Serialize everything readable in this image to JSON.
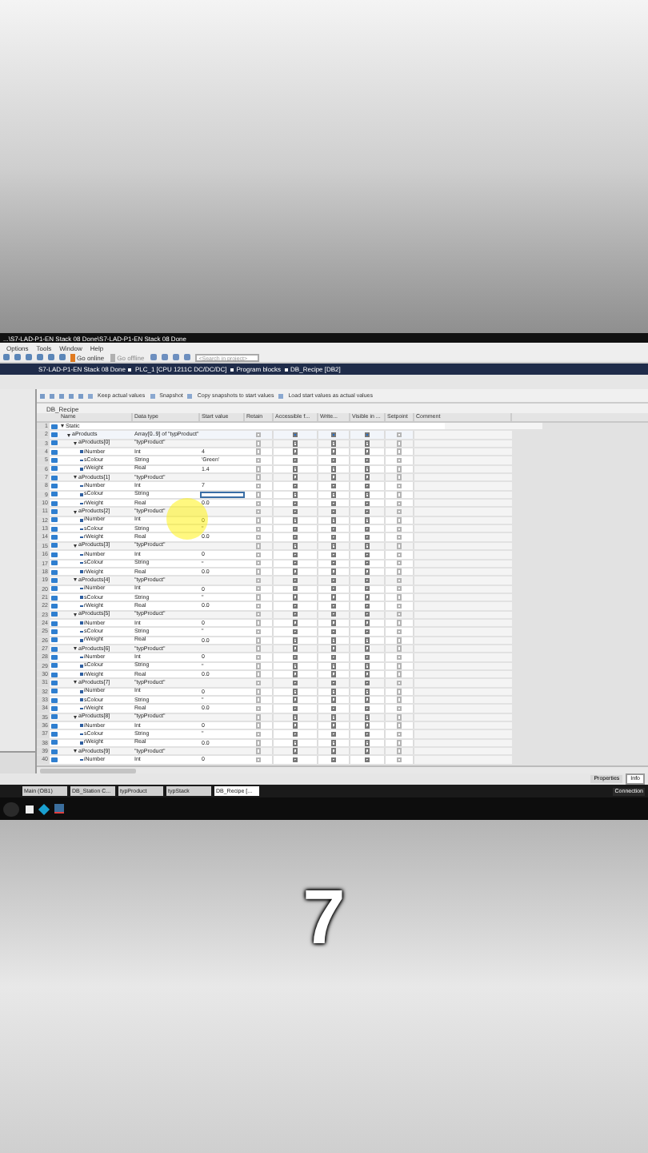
{
  "overlay_caption": "7",
  "window": {
    "title": "...\\S7-LAD-P1-EN Stack 08 Done\\S7-LAD-P1-EN Stack 08 Done"
  },
  "menu": [
    "Options",
    "Tools",
    "Window",
    "Help"
  ],
  "toolbar": {
    "go_online": "Go online",
    "go_offline": "Go offline",
    "search": {
      "placeholder": "<Search in project>"
    }
  },
  "breadcrumb": [
    "S7-LAD-P1-EN Stack 08 Done",
    "PLC_1 [CPU 1211C DC/DC/DC]",
    "Program blocks",
    "DB_Recipe [DB2]"
  ],
  "editor_toolbar": [
    "Keep actual values",
    "Snapshot",
    "Copy snapshots to start values",
    "Load start values as actual values"
  ],
  "block_title": "DB_Recipe",
  "table": {
    "columns": [
      "Name",
      "Data type",
      "Start value",
      "Retain",
      "Accessible f...",
      "Write...",
      "Visible in ...",
      "Setpoint",
      "Comment"
    ],
    "rows": [
      {
        "number": "1",
        "name": "Static",
        "kind": "section",
        "expanded": true,
        "children": [
          {
            "number": "2",
            "name": "aProducts",
            "kind": "array",
            "data_type": "Array[0..9] of \"typProduct\"",
            "expanded": true,
            "retain": false,
            "accessible": true,
            "write": true,
            "visible": true,
            "setpoint": false,
            "selected": false,
            "children": [
              {
                "number": "3",
                "name": "aProducts[0]",
                "kind": "struct",
                "data_type": "\"typProduct\"",
                "expanded": true,
                "retain": false,
                "accessible": true,
                "write": true,
                "visible": true,
                "setpoint": false,
                "selected": false,
                "children": [
                  {
                    "number": "4",
                    "name": "iNumber",
                    "kind": "field",
                    "data_type": "Int",
                    "start_value": "4",
                    "retain": false,
                    "accessible": true,
                    "write": true,
                    "visible": true,
                    "setpoint": false,
                    "selected": false
                  },
                  {
                    "number": "5",
                    "name": "sColour",
                    "kind": "field",
                    "data_type": "String",
                    "start_value": "'Green'",
                    "retain": false,
                    "accessible": true,
                    "write": true,
                    "visible": true,
                    "setpoint": false,
                    "selected": false
                  },
                  {
                    "number": "6",
                    "name": "rWeight",
                    "kind": "field",
                    "data_type": "Real",
                    "start_value": "1.4",
                    "retain": false,
                    "accessible": true,
                    "write": true,
                    "visible": true,
                    "setpoint": false,
                    "selected": false
                  }
                ]
              },
              {
                "number": "7",
                "name": "aProducts[1]",
                "kind": "struct",
                "data_type": "\"typProduct\"",
                "expanded": true,
                "retain": false,
                "accessible": true,
                "write": true,
                "visible": true,
                "setpoint": false,
                "selected": false,
                "children": [
                  {
                    "number": "8",
                    "name": "iNumber",
                    "kind": "field",
                    "data_type": "Int",
                    "start_value": "7",
                    "retain": false,
                    "accessible": true,
                    "write": true,
                    "visible": true,
                    "setpoint": false,
                    "selected": false
                  },
                  {
                    "number": "9",
                    "name": "sColour",
                    "kind": "field",
                    "data_type": "String",
                    "retain": false,
                    "accessible": true,
                    "write": true,
                    "visible": true,
                    "setpoint": false,
                    "selected": true
                  },
                  {
                    "number": "10",
                    "name": "rWeight",
                    "kind": "field",
                    "data_type": "Real",
                    "start_value": "0.0",
                    "retain": false,
                    "accessible": true,
                    "write": true,
                    "visible": true,
                    "setpoint": false,
                    "selected": false
                  }
                ]
              },
              {
                "number": "11",
                "name": "aProducts[2]",
                "kind": "struct",
                "data_type": "\"typProduct\"",
                "expanded": true,
                "retain": false,
                "accessible": true,
                "write": true,
                "visible": true,
                "setpoint": false,
                "selected": false,
                "children": [
                  {
                    "number": "12",
                    "name": "iNumber",
                    "kind": "field",
                    "data_type": "Int",
                    "start_value": "0",
                    "retain": false,
                    "accessible": true,
                    "write": true,
                    "visible": true,
                    "setpoint": false,
                    "selected": false
                  },
                  {
                    "number": "13",
                    "name": "sColour",
                    "kind": "field",
                    "data_type": "String",
                    "start_value": "''",
                    "retain": false,
                    "accessible": true,
                    "write": true,
                    "visible": true,
                    "setpoint": false,
                    "selected": false
                  },
                  {
                    "number": "14",
                    "name": "rWeight",
                    "kind": "field",
                    "data_type": "Real",
                    "start_value": "0.0",
                    "retain": false,
                    "accessible": true,
                    "write": true,
                    "visible": true,
                    "setpoint": false,
                    "selected": false
                  }
                ]
              },
              {
                "number": "15",
                "name": "aProducts[3]",
                "kind": "struct",
                "data_type": "\"typProduct\"",
                "expanded": true,
                "retain": false,
                "accessible": true,
                "write": true,
                "visible": true,
                "setpoint": false,
                "selected": false,
                "children": [
                  {
                    "number": "16",
                    "name": "iNumber",
                    "kind": "field",
                    "data_type": "Int",
                    "start_value": "0",
                    "retain": false,
                    "accessible": true,
                    "write": true,
                    "visible": true,
                    "setpoint": false,
                    "selected": false
                  },
                  {
                    "number": "17",
                    "name": "sColour",
                    "kind": "field",
                    "data_type": "String",
                    "start_value": "''",
                    "retain": false,
                    "accessible": true,
                    "write": true,
                    "visible": true,
                    "setpoint": false,
                    "selected": false
                  },
                  {
                    "number": "18",
                    "name": "rWeight",
                    "kind": "field",
                    "data_type": "Real",
                    "start_value": "0.0",
                    "retain": false,
                    "accessible": true,
                    "write": true,
                    "visible": true,
                    "setpoint": false,
                    "selected": false
                  }
                ]
              },
              {
                "number": "19",
                "name": "aProducts[4]",
                "kind": "struct",
                "data_type": "\"typProduct\"",
                "expanded": true,
                "retain": false,
                "accessible": true,
                "write": true,
                "visible": true,
                "setpoint": false,
                "selected": false,
                "children": [
                  {
                    "number": "20",
                    "name": "iNumber",
                    "kind": "field",
                    "data_type": "Int",
                    "start_value": "0",
                    "retain": false,
                    "accessible": true,
                    "write": true,
                    "visible": true,
                    "setpoint": false,
                    "selected": false
                  },
                  {
                    "number": "21",
                    "name": "sColour",
                    "kind": "field",
                    "data_type": "String",
                    "start_value": "''",
                    "retain": false,
                    "accessible": true,
                    "write": true,
                    "visible": true,
                    "setpoint": false,
                    "selected": false
                  },
                  {
                    "number": "22",
                    "name": "rWeight",
                    "kind": "field",
                    "data_type": "Real",
                    "start_value": "0.0",
                    "retain": false,
                    "accessible": true,
                    "write": true,
                    "visible": true,
                    "setpoint": false,
                    "selected": false
                  }
                ]
              },
              {
                "number": "23",
                "name": "aProducts[5]",
                "kind": "struct",
                "data_type": "\"typProduct\"",
                "expanded": true,
                "retain": false,
                "accessible": true,
                "write": true,
                "visible": true,
                "setpoint": false,
                "selected": false,
                "children": [
                  {
                    "number": "24",
                    "name": "iNumber",
                    "kind": "field",
                    "data_type": "Int",
                    "start_value": "0",
                    "retain": false,
                    "accessible": true,
                    "write": true,
                    "visible": true,
                    "setpoint": false,
                    "selected": false
                  },
                  {
                    "number": "25",
                    "name": "sColour",
                    "kind": "field",
                    "data_type": "String",
                    "start_value": "''",
                    "retain": false,
                    "accessible": true,
                    "write": true,
                    "visible": true,
                    "setpoint": false,
                    "selected": false
                  },
                  {
                    "number": "26",
                    "name": "rWeight",
                    "kind": "field",
                    "data_type": "Real",
                    "start_value": "0.0",
                    "retain": false,
                    "accessible": true,
                    "write": true,
                    "visible": true,
                    "setpoint": false,
                    "selected": false
                  }
                ]
              },
              {
                "number": "27",
                "name": "aProducts[6]",
                "kind": "struct",
                "data_type": "\"typProduct\"",
                "expanded": true,
                "retain": false,
                "accessible": true,
                "write": true,
                "visible": true,
                "setpoint": false,
                "selected": false,
                "children": [
                  {
                    "number": "28",
                    "name": "iNumber",
                    "kind": "field",
                    "data_type": "Int",
                    "start_value": "0",
                    "retain": false,
                    "accessible": true,
                    "write": true,
                    "visible": true,
                    "setpoint": false,
                    "selected": false
                  },
                  {
                    "number": "29",
                    "name": "sColour",
                    "kind": "field",
                    "data_type": "String",
                    "start_value": "''",
                    "retain": false,
                    "accessible": true,
                    "write": true,
                    "visible": true,
                    "setpoint": false,
                    "selected": false
                  },
                  {
                    "number": "30",
                    "name": "rWeight",
                    "kind": "field",
                    "data_type": "Real",
                    "start_value": "0.0",
                    "retain": false,
                    "accessible": true,
                    "write": true,
                    "visible": true,
                    "setpoint": false,
                    "selected": false
                  }
                ]
              },
              {
                "number": "31",
                "name": "aProducts[7]",
                "kind": "struct",
                "data_type": "\"typProduct\"",
                "expanded": true,
                "retain": false,
                "accessible": true,
                "write": true,
                "visible": true,
                "setpoint": false,
                "selected": false,
                "children": [
                  {
                    "number": "32",
                    "name": "iNumber",
                    "kind": "field",
                    "data_type": "Int",
                    "start_value": "0",
                    "retain": false,
                    "accessible": true,
                    "write": true,
                    "visible": true,
                    "setpoint": false,
                    "selected": false
                  },
                  {
                    "number": "33",
                    "name": "sColour",
                    "kind": "field",
                    "data_type": "String",
                    "start_value": "''",
                    "retain": false,
                    "accessible": true,
                    "write": true,
                    "visible": true,
                    "setpoint": false,
                    "selected": false
                  },
                  {
                    "number": "34",
                    "name": "rWeight",
                    "kind": "field",
                    "data_type": "Real",
                    "start_value": "0.0",
                    "retain": false,
                    "accessible": true,
                    "write": true,
                    "visible": true,
                    "setpoint": false,
                    "selected": false
                  }
                ]
              },
              {
                "number": "35",
                "name": "aProducts[8]",
                "kind": "struct",
                "data_type": "\"typProduct\"",
                "expanded": true,
                "retain": false,
                "accessible": true,
                "write": true,
                "visible": true,
                "setpoint": false,
                "selected": false,
                "children": [
                  {
                    "number": "36",
                    "name": "iNumber",
                    "kind": "field",
                    "data_type": "Int",
                    "start_value": "0",
                    "retain": false,
                    "accessible": true,
                    "write": true,
                    "visible": true,
                    "setpoint": false,
                    "selected": false
                  },
                  {
                    "number": "37",
                    "name": "sColour",
                    "kind": "field",
                    "data_type": "String",
                    "start_value": "''",
                    "retain": false,
                    "accessible": true,
                    "write": true,
                    "visible": true,
                    "setpoint": false,
                    "selected": false
                  },
                  {
                    "number": "38",
                    "name": "rWeight",
                    "kind": "field",
                    "data_type": "Real",
                    "start_value": "0.0",
                    "retain": false,
                    "accessible": true,
                    "write": true,
                    "visible": true,
                    "setpoint": false,
                    "selected": false
                  }
                ]
              },
              {
                "number": "39",
                "name": "aProducts[9]",
                "kind": "struct",
                "data_type": "\"typProduct\"",
                "expanded": true,
                "retain": false,
                "accessible": true,
                "write": true,
                "visible": true,
                "setpoint": false,
                "selected": false,
                "children": [
                  {
                    "number": "40",
                    "name": "iNumber",
                    "kind": "field",
                    "data_type": "Int",
                    "start_value": "0",
                    "retain": false,
                    "accessible": true,
                    "write": true,
                    "visible": true,
                    "setpoint": false,
                    "selected": false
                  }
                ]
              }
            ]
          }
        ]
      }
    ]
  },
  "inspector_tabs": [
    {
      "label": "Properties",
      "selected": false
    },
    {
      "label": "Info",
      "selected": true
    }
  ],
  "editor_tabs": [
    {
      "label": "Main (OB1)",
      "selected": false
    },
    {
      "label": "DB_Station C...",
      "selected": false
    },
    {
      "label": "typProduct",
      "selected": false
    },
    {
      "label": "typStack",
      "selected": false
    },
    {
      "label": "DB_Recipe [...",
      "selected": true
    }
  ],
  "status": "Connection"
}
